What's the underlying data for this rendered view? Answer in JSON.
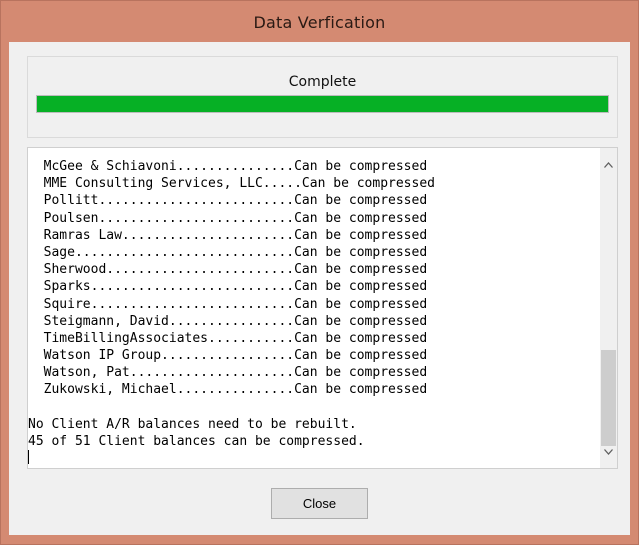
{
  "window": {
    "title": "Data Verfication"
  },
  "progress": {
    "status": "Complete",
    "fraction": 1.0,
    "color": "#06b025"
  },
  "log": {
    "lines": [
      "  McGee & Schiavoni...............Can be compressed",
      "  MME Consulting Services, LLC.....Can be compressed",
      "  Pollitt.........................Can be compressed",
      "  Poulsen.........................Can be compressed",
      "  Ramras Law......................Can be compressed",
      "  Sage............................Can be compressed",
      "  Sherwood........................Can be compressed",
      "  Sparks..........................Can be compressed",
      "  Squire..........................Can be compressed",
      "  Steigmann, David................Can be compressed",
      "  TimeBillingAssociates...........Can be compressed",
      "  Watson IP Group.................Can be compressed",
      "  Watson, Pat.....................Can be compressed",
      "  Zukowski, Michael...............Can be compressed",
      "",
      "No Client A/R balances need to be rebuilt.",
      "45 of 51 Client balances can be compressed."
    ]
  },
  "buttons": {
    "close_label": "Close"
  },
  "icons": {
    "scroll_up": "chevron-up-icon",
    "scroll_down": "chevron-down-icon"
  }
}
